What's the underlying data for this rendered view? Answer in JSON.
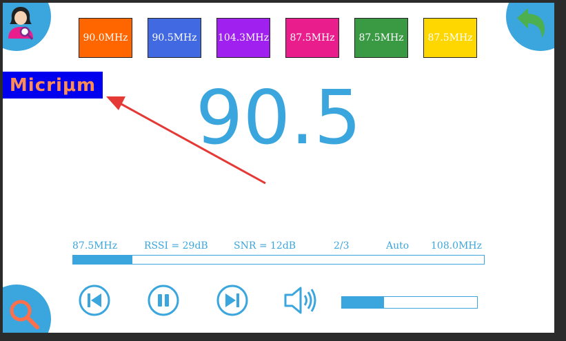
{
  "presets": [
    {
      "label": "90.0MHz",
      "color": "#ff6600"
    },
    {
      "label": "90.5MHz",
      "color": "#4169e1"
    },
    {
      "label": "104.3MHz",
      "color": "#a020f0"
    },
    {
      "label": "87.5MHz",
      "color": "#e91e8c"
    },
    {
      "label": "87.5MHz",
      "color": "#3a9a44"
    },
    {
      "label": "87.5MHz",
      "color": "#ffd700"
    }
  ],
  "logo": {
    "text": "Micriμm"
  },
  "frequency": "90.5",
  "status": {
    "min_freq": "87.5MHz",
    "rssi": "RSSI = 29dB",
    "snr": "SNR = 12dB",
    "channel": "2/3",
    "mode": "Auto",
    "max_freq": "108.0MHz"
  },
  "band_progress": 0.145,
  "volume_level": 0.31,
  "icons": {
    "top_left": "user-search-icon",
    "top_right": "back-arrow-icon",
    "bottom_left": "search-icon",
    "prev": "skip-previous-icon",
    "pause": "pause-icon",
    "next": "skip-next-icon",
    "volume": "speaker-icon"
  },
  "colors": {
    "accent": "#3aa6dd",
    "annotation": "#e53935"
  }
}
